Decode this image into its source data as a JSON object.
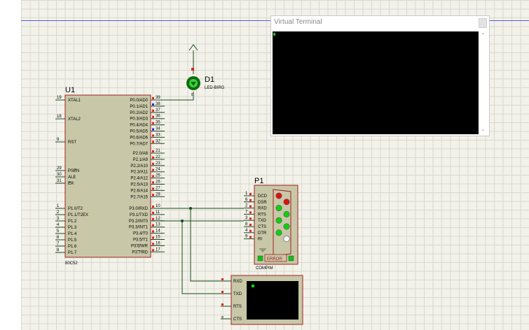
{
  "terminal": {
    "title": "Virtual Terminal"
  },
  "u1": {
    "ref": "U1",
    "part": "80C52",
    "left_pins": [
      {
        "num": "19",
        "name": "XTAL1"
      },
      {
        "num": "18",
        "name": "XTAL2"
      },
      {
        "num": "9",
        "name": "RST"
      },
      {
        "num": "29",
        "name": "PSEN"
      },
      {
        "num": "30",
        "name": "ALE"
      },
      {
        "num": "31",
        "name": "EA"
      },
      {
        "num": "1",
        "name": "P1.0/T2"
      },
      {
        "num": "2",
        "name": "P1.1/T2EX"
      },
      {
        "num": "3",
        "name": "P1.2"
      },
      {
        "num": "4",
        "name": "P1.3"
      },
      {
        "num": "5",
        "name": "P1.4"
      },
      {
        "num": "6",
        "name": "P1.5"
      },
      {
        "num": "7",
        "name": "P1.6"
      },
      {
        "num": "8",
        "name": "P1.7"
      }
    ],
    "right_pins": [
      {
        "num": "39",
        "name": "P0.0/AD0"
      },
      {
        "num": "38",
        "name": "P0.1/AD1"
      },
      {
        "num": "37",
        "name": "P0.2/AD2"
      },
      {
        "num": "36",
        "name": "P0.3/AD3"
      },
      {
        "num": "35",
        "name": "P0.4/AD4"
      },
      {
        "num": "34",
        "name": "P0.5/AD5"
      },
      {
        "num": "33",
        "name": "P0.6/AD6"
      },
      {
        "num": "32",
        "name": "P0.7/AD7"
      },
      {
        "num": "21",
        "name": "P2.0/A8"
      },
      {
        "num": "22",
        "name": "P2.1/A9"
      },
      {
        "num": "23",
        "name": "P2.2/A10"
      },
      {
        "num": "24",
        "name": "P2.3/A11"
      },
      {
        "num": "25",
        "name": "P2.4/A12"
      },
      {
        "num": "26",
        "name": "P2.5/A13"
      },
      {
        "num": "27",
        "name": "P2.6/A14"
      },
      {
        "num": "28",
        "name": "P2.7/A15"
      },
      {
        "num": "10",
        "name": "P3.0/RXD"
      },
      {
        "num": "11",
        "name": "P3.1/TXD"
      },
      {
        "num": "12",
        "name": "P3.2/INT0"
      },
      {
        "num": "13",
        "name": "P3.3/INT1"
      },
      {
        "num": "14",
        "name": "P3.4/T0"
      },
      {
        "num": "15",
        "name": "P3.5/T1"
      },
      {
        "num": "16",
        "name": "P3.6/WR"
      },
      {
        "num": "17",
        "name": "P3.7/RD"
      }
    ]
  },
  "d1": {
    "ref": "D1",
    "part": "LED-BIRG"
  },
  "p1": {
    "ref": "P1",
    "part": "COMPIM",
    "error_label": "ERROR",
    "pins": [
      {
        "num": "1",
        "name": "DCD",
        "led": "#e01010"
      },
      {
        "num": "6",
        "name": "DSR",
        "led": "#e01010"
      },
      {
        "num": "2",
        "name": "RXD",
        "led": "#10d010"
      },
      {
        "num": "7",
        "name": "RTS",
        "led": "#10d010"
      },
      {
        "num": "3",
        "name": "TXD",
        "led": "#10d010"
      },
      {
        "num": "8",
        "name": "CTS",
        "led": "#10d010"
      },
      {
        "num": "4",
        "name": "DTR",
        "led": "#10d010"
      },
      {
        "num": "9",
        "name": "RI",
        "led": "#ffffff"
      }
    ]
  },
  "vterm": {
    "pins": [
      "RXD",
      "TXD",
      "RTS",
      "CTS"
    ]
  },
  "colors": {
    "wire": "#1a4a1a",
    "body": "#c8c8a8",
    "border": "#a02020",
    "pin_num": "#303030"
  }
}
